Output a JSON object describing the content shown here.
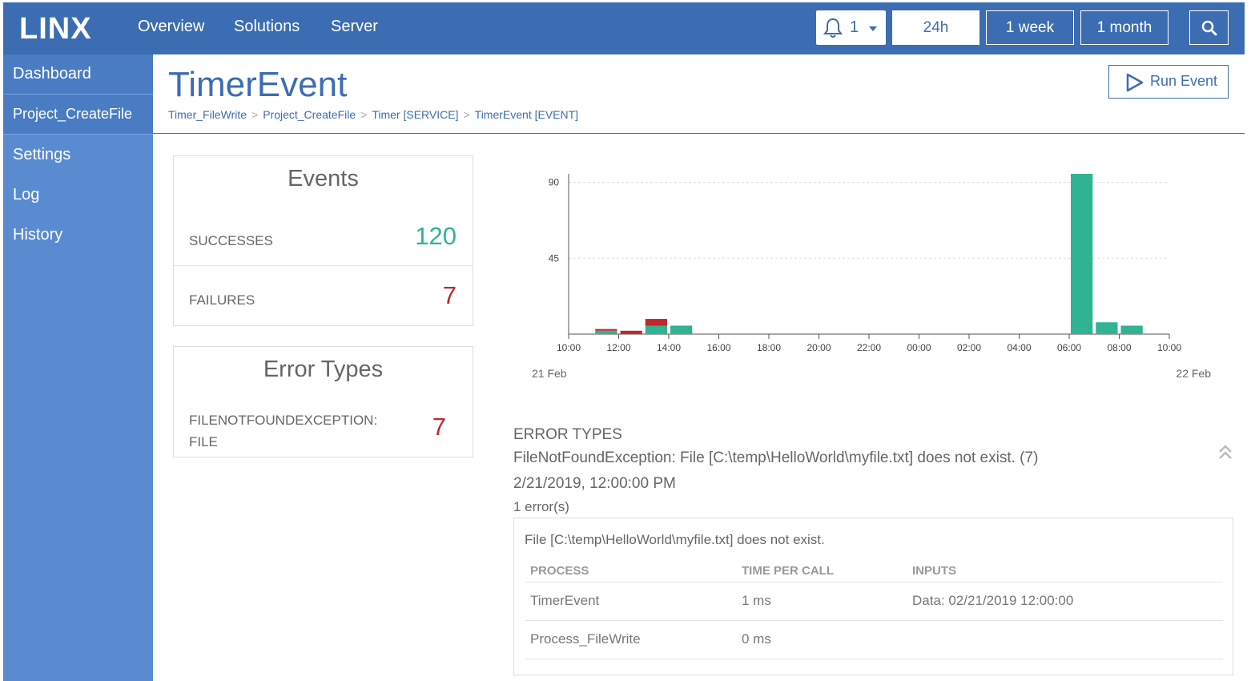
{
  "app": {
    "logo_text": "LINX",
    "nav": [
      "Overview",
      "Solutions",
      "Server"
    ],
    "notifications_count": "1",
    "ranges": [
      "24h",
      "1 week",
      "1 month"
    ],
    "selected_range": "24h",
    "colors": {
      "header": "#3c6db3",
      "sidebar": "#5a8ad0",
      "success": "#2fb393",
      "failure": "#c0282e"
    }
  },
  "sidebar": {
    "items": [
      {
        "label": "Dashboard"
      },
      {
        "label": "Project_CreateFile"
      },
      {
        "label": "Settings"
      },
      {
        "label": "Log"
      },
      {
        "label": "History"
      }
    ]
  },
  "header": {
    "title": "TimerEvent",
    "breadcrumb": [
      "Timer_FileWrite",
      "Project_CreateFile",
      "Timer [SERVICE]",
      "TimerEvent [EVENT]"
    ],
    "breadcrumb_separator": ">",
    "run_button": "Run Event"
  },
  "events_card": {
    "title": "Events",
    "successes_label": "SUCCESSES",
    "successes_value": "120",
    "failures_label": "FAILURES",
    "failures_value": "7"
  },
  "error_types_card": {
    "title": "Error Types",
    "type_label": "FILENOTFOUNDEXCEPTION: FILE",
    "type_value": "7"
  },
  "chart_data": {
    "type": "bar",
    "stacked": true,
    "x_ticks": [
      "10:00",
      "12:00",
      "14:00",
      "16:00",
      "18:00",
      "20:00",
      "22:00",
      "00:00",
      "02:00",
      "04:00",
      "06:00",
      "08:00",
      "10:00"
    ],
    "y_ticks": [
      45,
      90
    ],
    "ylim": [
      0,
      95
    ],
    "grid": true,
    "date_labels": [
      "21 Feb",
      "22 Feb"
    ],
    "series": [
      {
        "color": "#2fb393",
        "values": [
          {
            "x": "11:00",
            "y": 2
          },
          {
            "x": "12:00",
            "y": 0
          },
          {
            "x": "13:00",
            "y": 5
          },
          {
            "x": "14:00",
            "y": 5
          },
          {
            "x": "06:00",
            "y": 95
          },
          {
            "x": "07:00",
            "y": 7
          },
          {
            "x": "08:00",
            "y": 5
          }
        ]
      },
      {
        "color": "#c0282e",
        "values": [
          {
            "x": "11:00",
            "y": 1
          },
          {
            "x": "12:00",
            "y": 2
          },
          {
            "x": "13:00",
            "y": 4
          },
          {
            "x": "14:00",
            "y": 0
          },
          {
            "x": "06:00",
            "y": 0
          },
          {
            "x": "07:00",
            "y": 0
          },
          {
            "x": "08:00",
            "y": 0
          }
        ]
      }
    ]
  },
  "error_section": {
    "title": "ERROR TYPES",
    "message": "FileNotFoundException: File [C:\\temp\\HelloWorld\\myfile.txt] does not exist. (7)",
    "date": "2/21/2019, 12:00:00 PM",
    "count": "1 error(s)",
    "detail": {
      "message": "File [C:\\temp\\HelloWorld\\myfile.txt] does not exist.",
      "columns": [
        "PROCESS",
        "TIME PER CALL",
        "INPUTS"
      ],
      "rows": [
        [
          "TimerEvent",
          "1 ms",
          "Data: 02/21/2019 12:00:00"
        ],
        [
          "Process_FileWrite",
          "0 ms",
          ""
        ]
      ]
    }
  }
}
